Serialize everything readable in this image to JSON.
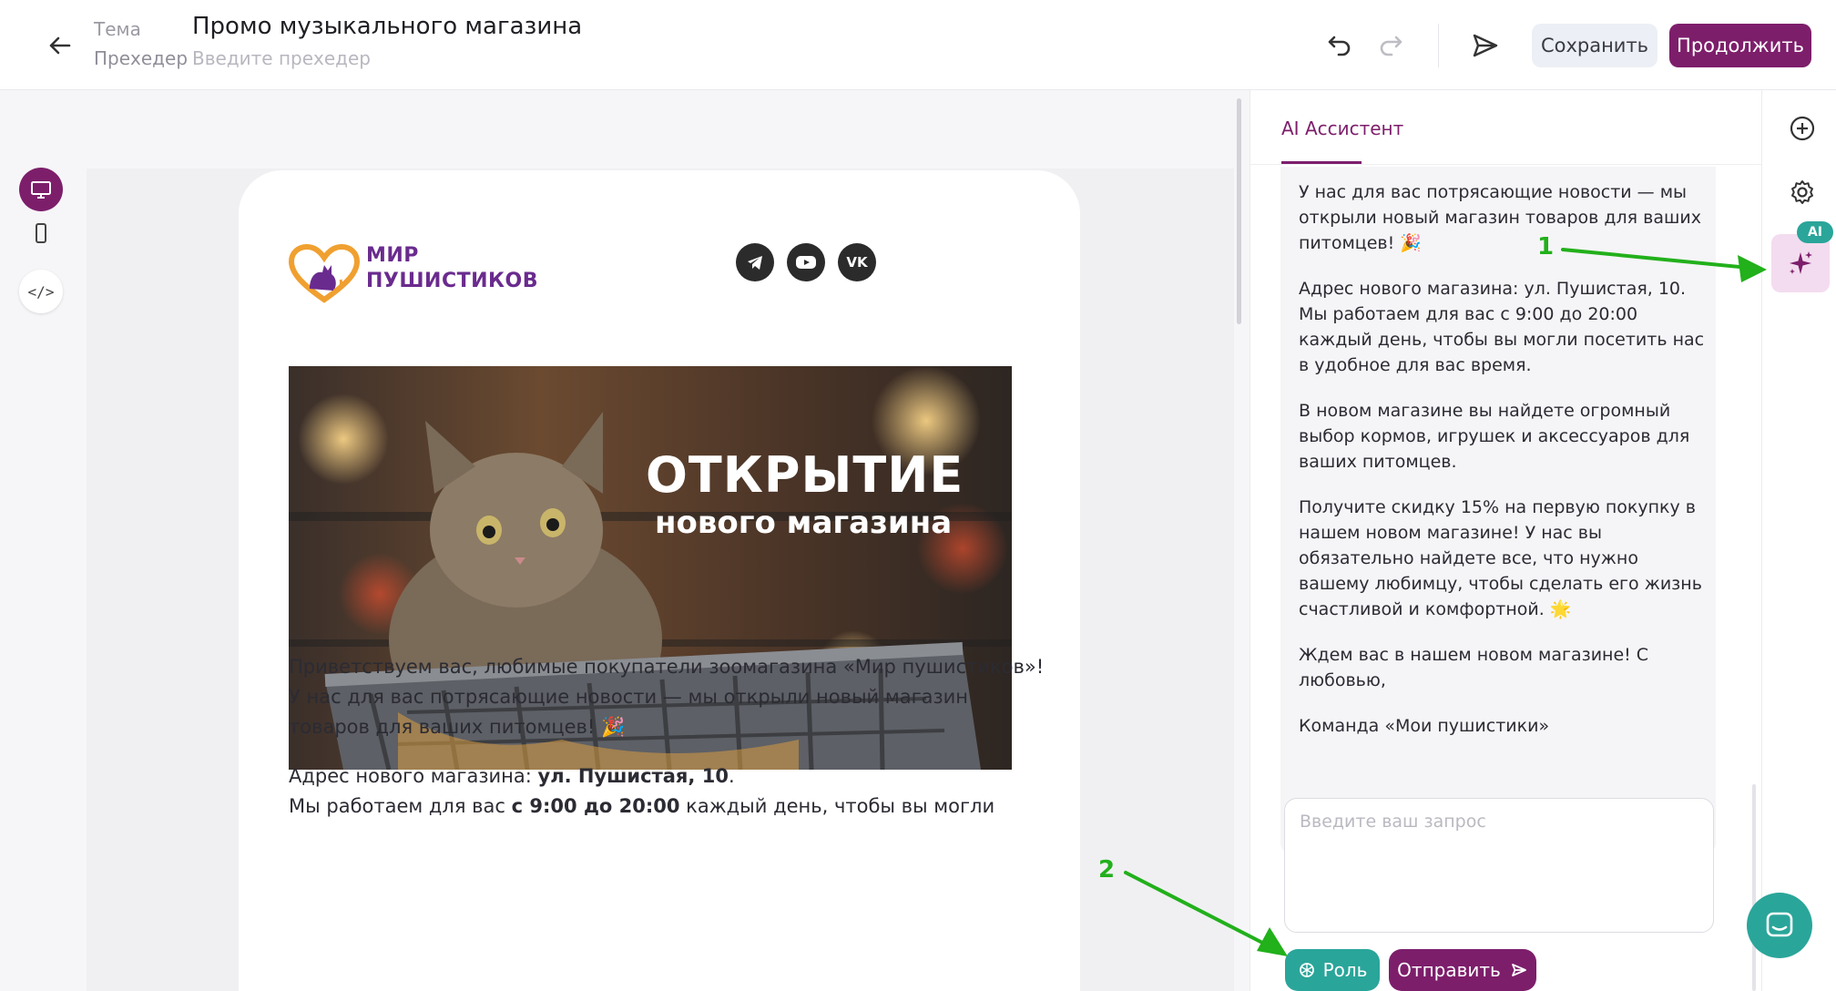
{
  "header": {
    "theme_label": "Тема",
    "preheader_label": "Прехедер",
    "title": "Промо музыкального магазина",
    "preheader_placeholder": "Введите прехедер",
    "save_label": "Сохранить",
    "continue_label": "Продолжить"
  },
  "icons": {
    "back": "arrow-left-icon",
    "undo": "undo-icon",
    "redo": "redo-icon",
    "send": "paper-plane-icon",
    "desktop": "desktop-icon",
    "mobile": "mobile-icon",
    "code": "code-icon",
    "add": "plus-circle-icon",
    "settings": "gear-icon",
    "ai": "sparkles-icon",
    "chat": "chat-icon"
  },
  "left_tools": {
    "code_glyph": "</>"
  },
  "email": {
    "brand_line1": "МИР",
    "brand_line2": "ПУШИСТИКОВ",
    "social": [
      "telegram",
      "youtube",
      "vk"
    ],
    "vk_glyph": "VK",
    "hero_title": "ОТКРЫТИЕ",
    "hero_subtitle": "нового магазина",
    "paragraph1": "Приветствуем вас, любимые покупатели зоомагазина «Мир пушистиков»! У нас для вас потрясающие новости — мы открыли новый магазин товаров для ваших питомцев! 🎉",
    "address_prefix": "Адрес нового магазина: ",
    "address_bold": "ул. Пушистая, 10",
    "address_suffix": ".",
    "hours_prefix": "Мы работаем для вас ",
    "hours_bold": "с 9:00 до 20:00",
    "hours_suffix": " каждый день, чтобы вы могли"
  },
  "panel": {
    "tab_label": "AI Ассистент",
    "messages": [
      "У нас для вас потрясающие новости — мы открыли новый магазин товаров для ваших питомцев! 🎉",
      "Адрес нового магазина: ул. Пушистая, 10. Мы работаем для вас с 9:00 до 20:00 каждый день, чтобы вы могли посетить нас в удобное для вас время.",
      "В новом магазине вы найдете огромный выбор кормов, игрушек и аксессуаров для ваших питомцев.",
      "Получите скидку 15% на первую покупку в нашем новом магазине! У нас вы обязательно найдете все, что нужно вашему любимцу, чтобы сделать его жизнь счастливой и комфортной. 🌟",
      "Ждем вас в нашем новом магазине! С любовью,",
      "Команда «Мои пушистики»"
    ],
    "input_placeholder": "Введите ваш запрос",
    "role_label": "Роль",
    "send_label": "Отправить"
  },
  "rail": {
    "ai_badge": "AI"
  },
  "annotations": {
    "one": "1",
    "two": "2"
  },
  "colors": {
    "accent": "#7d1e6b",
    "teal": "#2aa59a",
    "annotation": "#22b01b"
  }
}
